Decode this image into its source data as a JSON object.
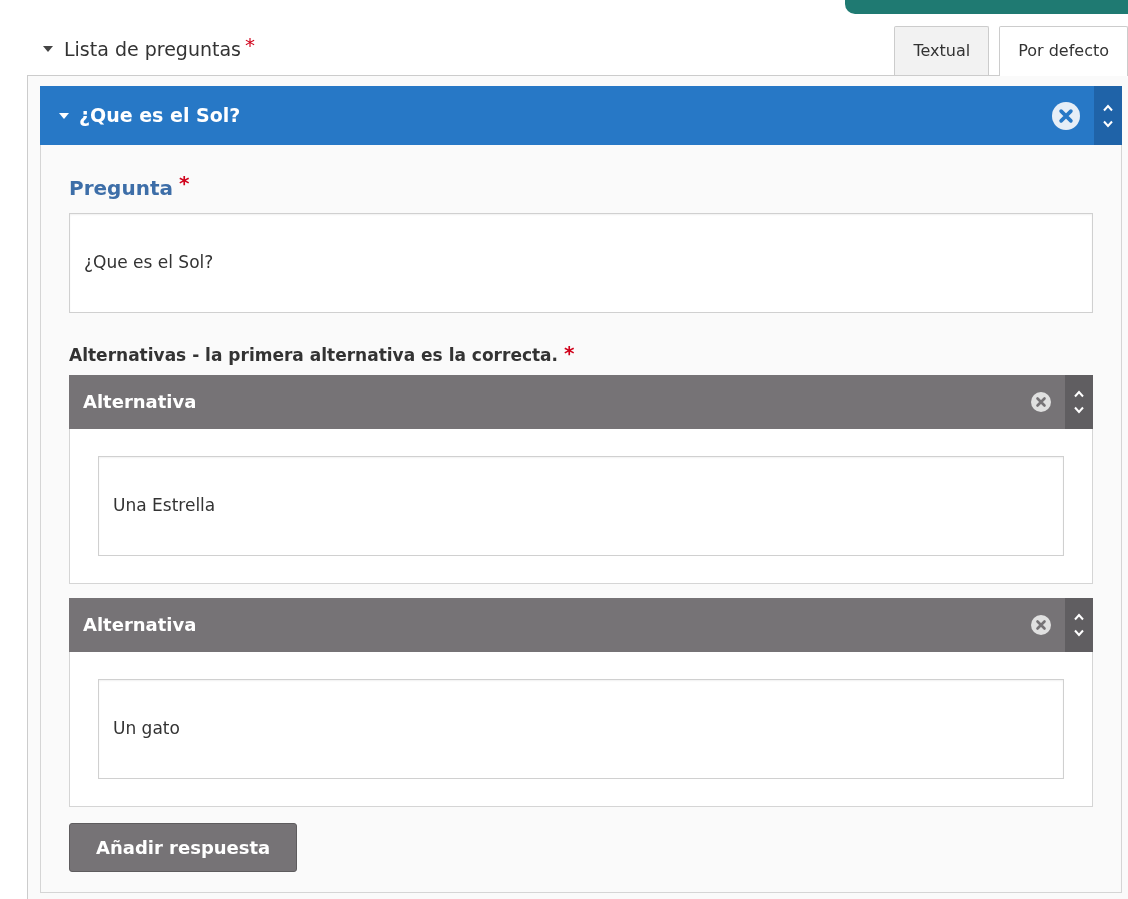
{
  "section": {
    "title": "Lista de preguntas",
    "required_mark": "*",
    "expanded": true
  },
  "tabs": [
    {
      "label": "Textual",
      "selected": false
    },
    {
      "label": "Por defecto",
      "selected": true
    }
  ],
  "question": {
    "title": "¿Que es el Sol?",
    "expanded": true,
    "field_label": "Pregunta",
    "field_required_mark": "*",
    "value": "¿Que es el Sol?",
    "alternatives_label": "Alternativas - la primera alternativa es la correcta.",
    "alternatives_required_mark": "*",
    "alternatives": [
      {
        "title": "Alternativa",
        "value": "Una Estrella"
      },
      {
        "title": "Alternativa",
        "value": "Un gato"
      }
    ],
    "add_button": "Añadir respuesta"
  }
}
